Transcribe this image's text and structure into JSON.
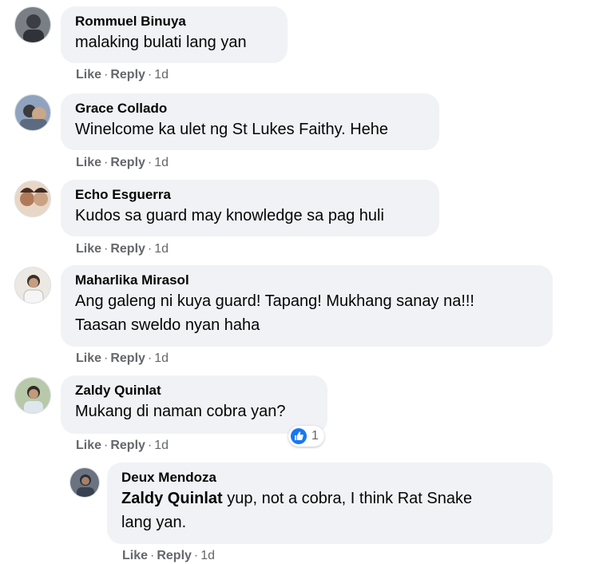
{
  "comments": [
    {
      "author": "Rommuel Binuya",
      "lines": [
        "malaking bulati lang yan"
      ],
      "like": "Like",
      "reply": "Reply",
      "time": "1d",
      "avatar_color": "#6b7280"
    },
    {
      "author": "Grace Collado",
      "lines": [
        "Winelcome ka ulet ng St Lukes Faithy. Hehe"
      ],
      "like": "Like",
      "reply": "Reply",
      "time": "1d",
      "avatar_color": "#5b6f8a"
    },
    {
      "author": "Echo Esguerra",
      "lines": [
        "Kudos sa guard may knowledge sa pag huli"
      ],
      "like": "Like",
      "reply": "Reply",
      "time": "1d",
      "avatar_color": "#a0785a"
    },
    {
      "author": "Maharlika Mirasol",
      "lines": [
        "Ang galeng ni kuya guard! Tapang! Mukhang sanay na!!!",
        "Taasan sweldo nyan haha"
      ],
      "like": "Like",
      "reply": "Reply",
      "time": "1d",
      "avatar_color": "#d8d2c8"
    },
    {
      "author": "Zaldy Quinlat",
      "lines": [
        "Mukang di naman cobra yan?"
      ],
      "like": "Like",
      "reply": "Reply",
      "time": "1d",
      "avatar_color": "#8aa07a",
      "reaction_count": "1"
    }
  ],
  "reply": {
    "author": "Deux Mendoza",
    "mention": "Zaldy Quinlat",
    "line1": " yup, not a cobra, I think Rat Snake",
    "line2": "lang yan.",
    "like": "Like",
    "reply": "Reply",
    "time": "1d",
    "avatar_color": "#4b5563"
  },
  "colors": {
    "bubble": "#f0f2f5",
    "meta": "#65676b",
    "like_blue": "#1877f2"
  }
}
